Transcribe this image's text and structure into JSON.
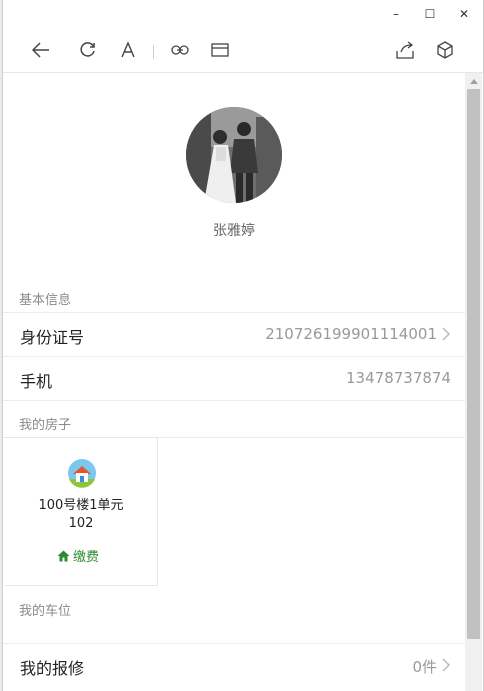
{
  "window": {
    "minimize_label": "–",
    "maximize_label": "☐",
    "close_label": "✕"
  },
  "toolbar": {
    "icons": [
      "back-icon",
      "refresh-icon",
      "font-size-icon",
      "link-icon",
      "window-icon",
      "share-icon",
      "cube-icon"
    ]
  },
  "profile": {
    "name": "张雅婷"
  },
  "basic_info": {
    "section_label": "基本信息",
    "id_label": "身份证号",
    "id_value": "210726199901114001",
    "phone_label": "手机",
    "phone_value": "13478737874"
  },
  "houses": {
    "section_label": "我的房子",
    "items": [
      {
        "name": "100号楼1单元",
        "number": "102",
        "pay_label": "缴费"
      }
    ]
  },
  "parking": {
    "section_label": "我的车位"
  },
  "repairs": {
    "label": "我的报修",
    "count": "0件"
  },
  "colors": {
    "accent_green": "#2e8b2e",
    "muted_text": "#999999",
    "divider": "#ececec"
  }
}
